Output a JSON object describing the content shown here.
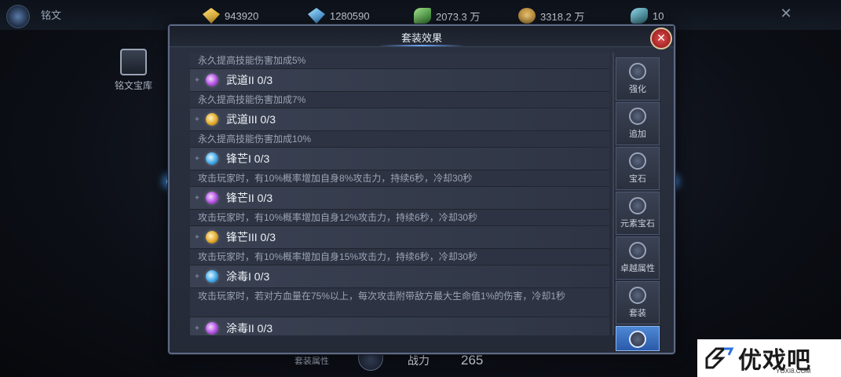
{
  "topbar": {
    "title": "铭文",
    "resources": [
      {
        "icon": "gold-gem-icon",
        "value": "943920"
      },
      {
        "icon": "blue-gem-icon",
        "value": "1280590"
      },
      {
        "icon": "leaf-icon",
        "value": "2073.3 万"
      },
      {
        "icon": "coin-icon",
        "value": "3318.2 万"
      },
      {
        "icon": "fish-icon",
        "value": "10"
      }
    ],
    "close": "✕"
  },
  "background": {
    "vault_label": "铭文宝库",
    "set_attr_label": "套装属性",
    "power_label": "战力",
    "power_value": "265"
  },
  "modal": {
    "title": "套装效果",
    "close": "✕",
    "items": [
      {
        "desc_above": "永久提高技能伤害加成5%",
        "name": "武道II 0/3",
        "gem": "purple"
      },
      {
        "desc_above": "永久提高技能伤害加成7%",
        "name": "武道III 0/3",
        "gem": "gold"
      },
      {
        "desc_above": "永久提高技能伤害加成10%",
        "name": "锋芒I 0/3",
        "gem": "blue"
      },
      {
        "desc_above": "攻击玩家时，有10%概率增加自身8%攻击力，持续6秒，冷却30秒",
        "name": "锋芒II 0/3",
        "gem": "purple"
      },
      {
        "desc_above": "攻击玩家时，有10%概率增加自身12%攻击力，持续6秒，冷却30秒",
        "name": "锋芒III 0/3",
        "gem": "gold"
      },
      {
        "desc_above": "攻击玩家时，有10%概率增加自身15%攻击力，持续6秒，冷却30秒",
        "name": "涂毒I 0/3",
        "gem": "blue"
      },
      {
        "desc_above": "攻击玩家时，若对方血量在75%以上，每次攻击附带敌方最大生命值1%的伤害，冷却1秒",
        "name": "涂毒II 0/3",
        "gem": "purple"
      }
    ],
    "tabs": [
      {
        "label": "强化",
        "icon": "anvil-icon"
      },
      {
        "label": "追加",
        "icon": "plus-emblem-icon"
      },
      {
        "label": "宝石",
        "icon": "gem-emblem-icon"
      },
      {
        "label": "元素宝石",
        "icon": "element-gem-icon"
      },
      {
        "label": "卓越属性",
        "icon": "sword-emblem-icon"
      },
      {
        "label": "套装",
        "icon": "crest-icon"
      },
      {
        "label": "",
        "icon": "active-tab-icon",
        "active": true
      }
    ]
  },
  "watermark": {
    "text": "优戏吧",
    "url": "YOXI8.COM"
  }
}
